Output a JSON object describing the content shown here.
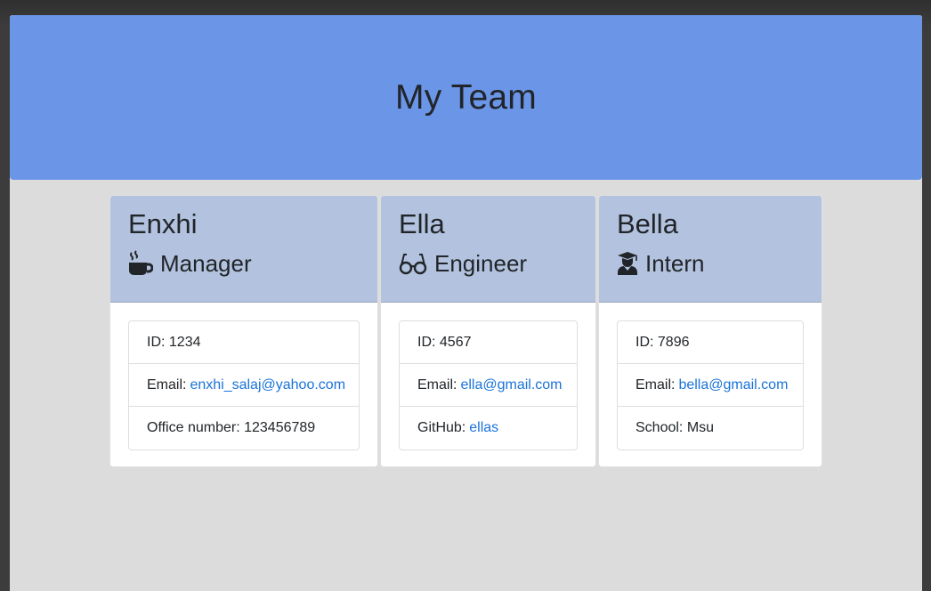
{
  "header": {
    "title": "My Team"
  },
  "colors": {
    "jumbotron": "#6b95e6",
    "card_header": "#b3c3df",
    "link": "#1a73d9",
    "page_bg": "#dcdcdc"
  },
  "cards": [
    {
      "name": "Enxhi",
      "role": "Manager",
      "role_icon": "coffee-mug-icon",
      "id_label": "ID:",
      "id_value": "1234",
      "email_label": "Email:",
      "email": "enxhi_salaj@yahoo.com",
      "extra_label": "Office number:",
      "extra_value": "123456789"
    },
    {
      "name": "Ella",
      "role": "Engineer",
      "role_icon": "glasses-icon",
      "id_label": "ID:",
      "id_value": "4567",
      "email_label": "Email:",
      "email": "ella@gmail.com",
      "extra_label": "GitHub:",
      "extra_value": "ellas"
    },
    {
      "name": "Bella",
      "role": "Intern",
      "role_icon": "graduate-icon",
      "id_label": "ID:",
      "id_value": "7896",
      "email_label": "Email:",
      "email": "bella@gmail.com",
      "extra_label": "School:",
      "extra_value": "Msu"
    }
  ]
}
